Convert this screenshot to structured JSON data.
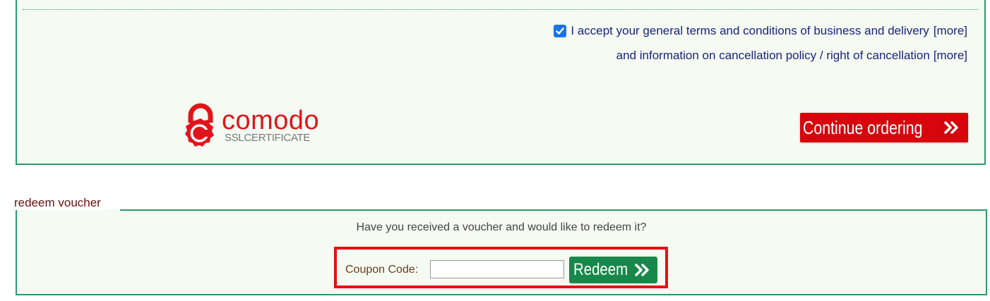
{
  "order": {
    "terms_checkbox_checked": true,
    "terms_text": "I accept your general terms and conditions of business and delivery",
    "terms_more": "[more]",
    "cancellation_text": "and information on cancellation policy / right of cancellation",
    "cancellation_more": "[more]",
    "ssl_brand": "comodo",
    "ssl_sub": "SSLCERTIFICATE",
    "continue_label": "Continue ordering"
  },
  "voucher": {
    "legend": "redeem voucher",
    "question": "Have you received a voucher and would like to redeem it?",
    "coupon_label": "Coupon Code:",
    "coupon_value": "",
    "coupon_placeholder": "",
    "redeem_label": "Redeem"
  },
  "colors": {
    "border_green": "#2a9a6c",
    "panel_bg": "#f5fbf2",
    "continue_red": "#d6060c",
    "redeem_green": "#18884a",
    "highlight_red": "#e81010",
    "link_navy": "#1a237e",
    "comodo_red": "#e0151b"
  },
  "icons": {
    "checkbox": "check-icon",
    "continue": "double-chevron-right-icon",
    "redeem": "double-chevron-right-icon",
    "ssl": "padlock-icon"
  }
}
